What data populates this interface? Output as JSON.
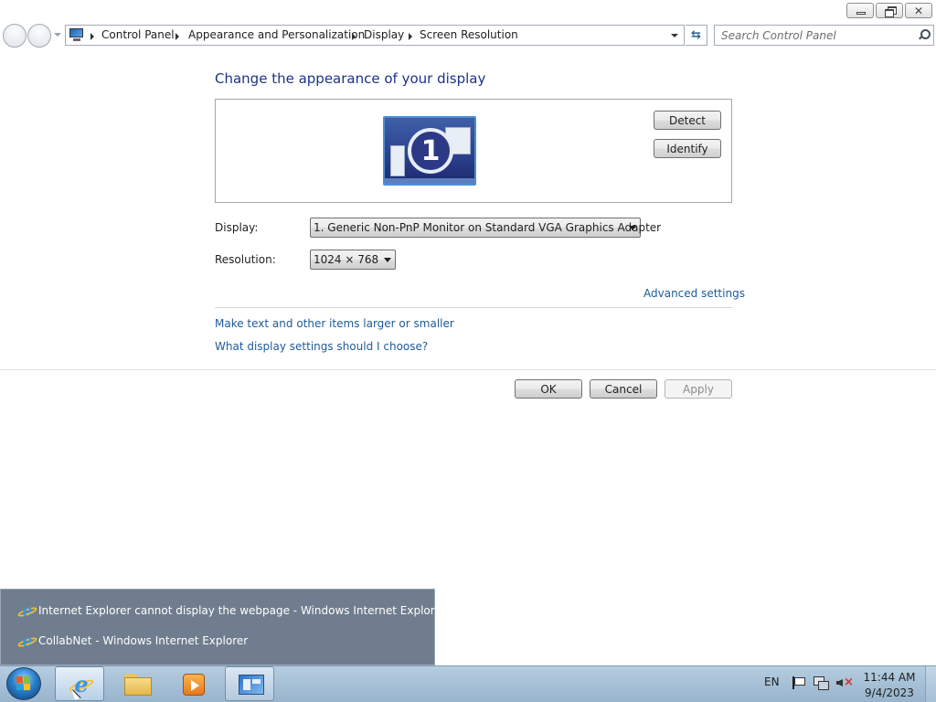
{
  "window": {
    "minimize_icon": "minimize-icon",
    "maximize_icon": "restore-icon",
    "close_icon": "close-icon"
  },
  "nav": {
    "back_icon": "back-arrow-icon",
    "forward_icon": "forward-arrow-icon",
    "breadcrumbs": [
      "Control Panel",
      "Appearance and Personalization",
      "Display",
      "Screen Resolution"
    ],
    "search_placeholder": "Search Control Panel"
  },
  "main": {
    "title": "Change the appearance of your display",
    "monitor_number": "1",
    "detect_label": "Detect",
    "identify_label": "Identify",
    "display_label": "Display:",
    "display_value": "1. Generic Non-PnP Monitor on Standard VGA Graphics Adapter",
    "resolution_label": "Resolution:",
    "resolution_value": "1024 × 768",
    "advanced_link": "Advanced settings",
    "link_text_size": "Make text and other items larger or smaller",
    "link_settings_help": "What display settings should I choose?",
    "ok_label": "OK",
    "cancel_label": "Cancel",
    "apply_label": "Apply"
  },
  "popup": {
    "items": [
      "Internet Explorer cannot display the webpage - Windows Internet Explorer",
      "CollabNet - Windows Internet Explorer"
    ]
  },
  "taskbar": {
    "pinned": [
      "ie-icon",
      "folder-icon",
      "media-player-icon",
      "control-panel-icon"
    ],
    "lang": "EN",
    "time": "11:44 AM",
    "date": "9/4/2023"
  },
  "colors": {
    "title_blue": "#1e3287",
    "link_blue": "#1e5a96",
    "popup_bg": "#6f7d8e",
    "taskbar_bg": "#a6c0d6"
  }
}
